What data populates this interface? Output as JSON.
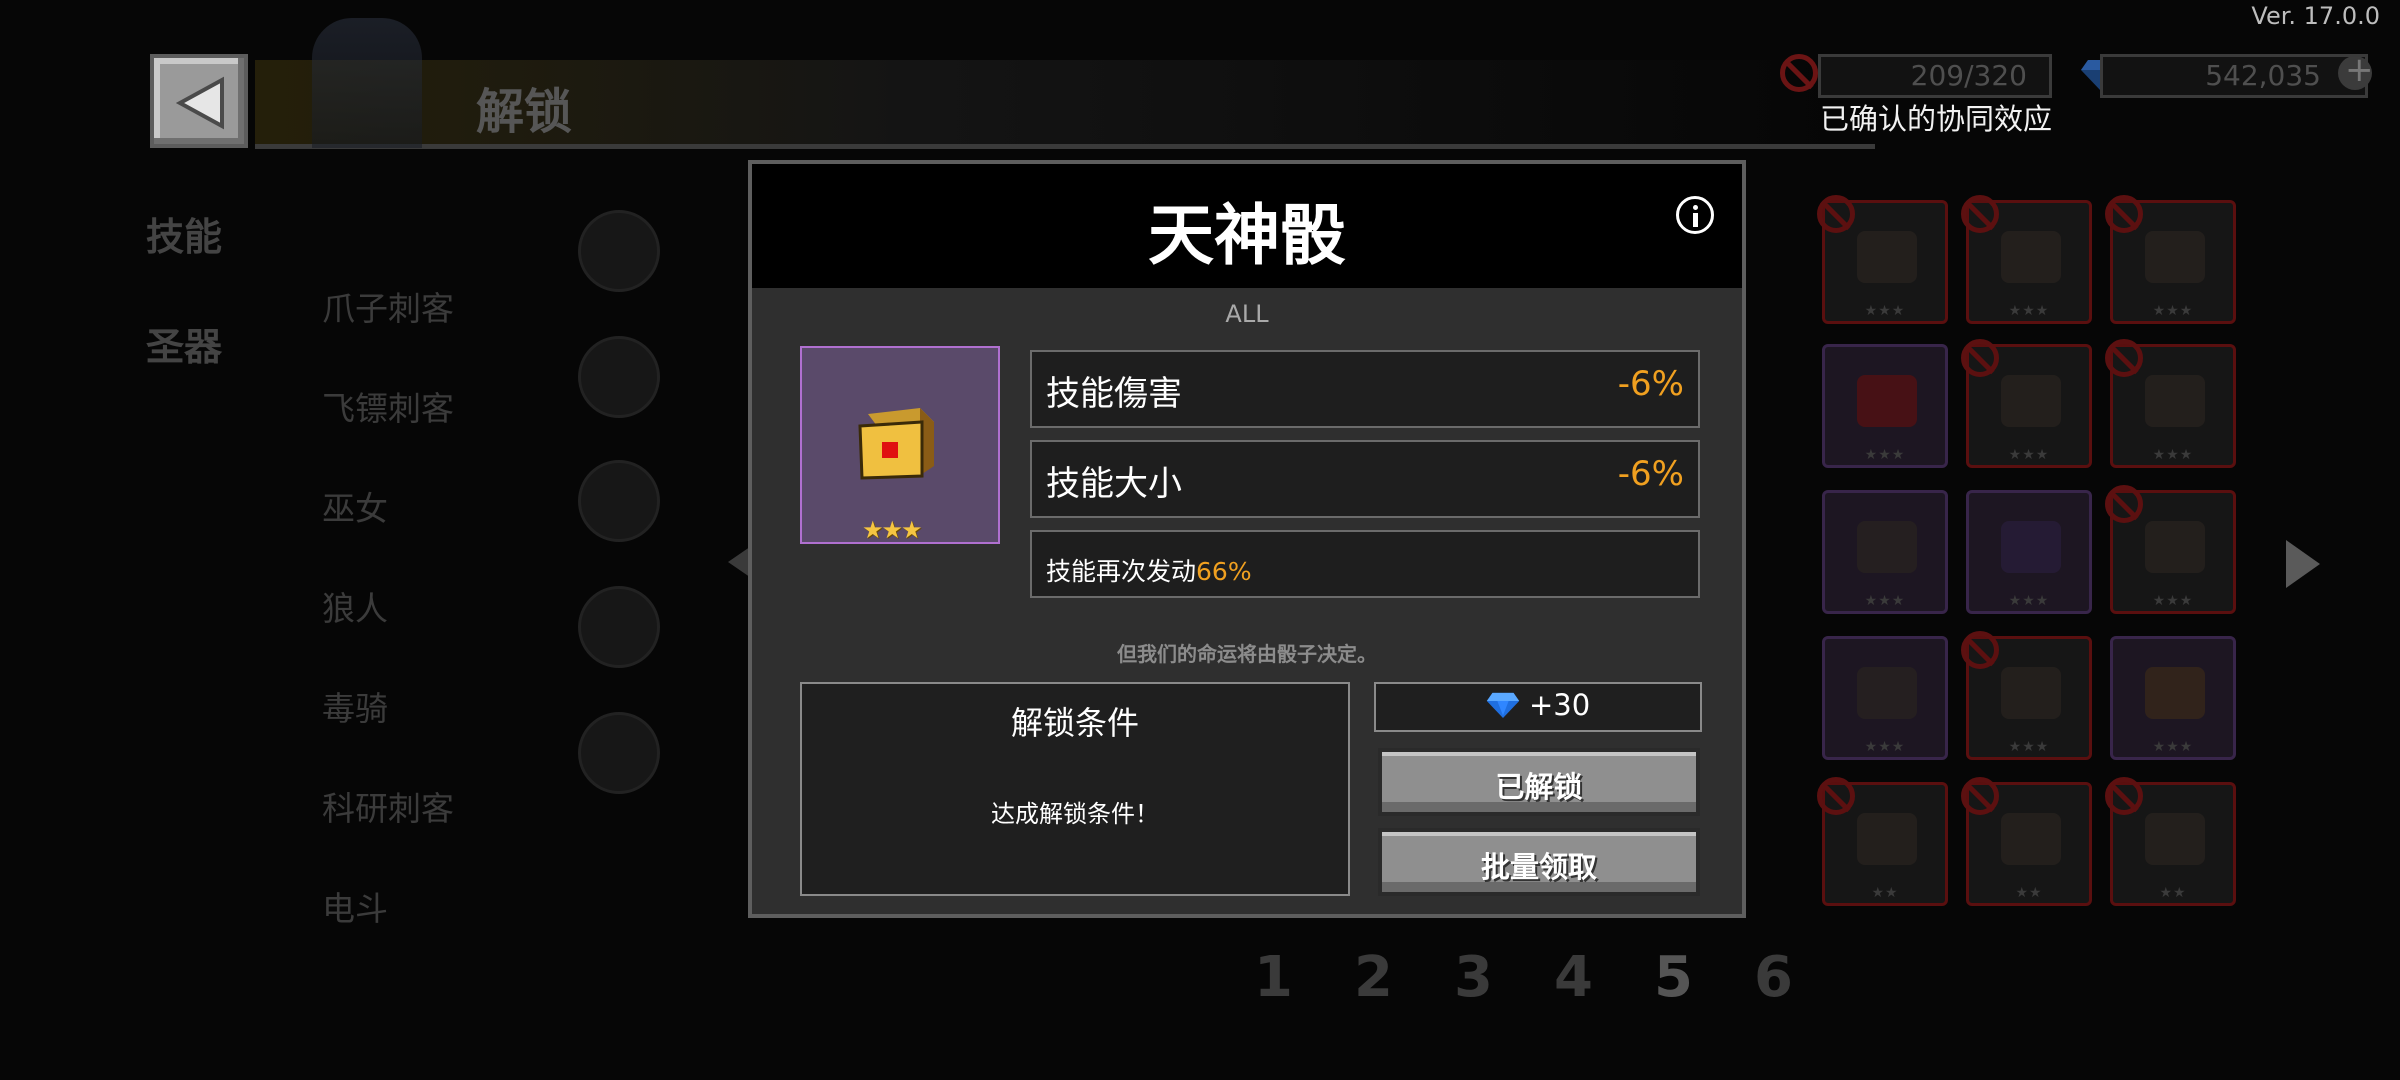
{
  "app": {
    "version": "Ver. 17.0.0"
  },
  "header": {
    "title": "解锁",
    "resource1": {
      "value": "209/320",
      "icon": "forbidden-icon"
    },
    "resource2": {
      "value": "542,035",
      "icon": "diamond-icon"
    },
    "synergy_label": "已确认的协同效应"
  },
  "sidebar": {
    "categories": [
      {
        "label": "技能"
      },
      {
        "label": "圣器"
      }
    ]
  },
  "classes": [
    {
      "label": "爪子刺客"
    },
    {
      "label": "飞镖刺客"
    },
    {
      "label": "巫女"
    },
    {
      "label": "狼人"
    },
    {
      "label": "毒骑"
    },
    {
      "label": "科研刺客"
    },
    {
      "label": "电斗"
    }
  ],
  "pagination": {
    "pages": [
      "1",
      "2",
      "3",
      "4",
      "5",
      "6"
    ],
    "current": "5"
  },
  "modal": {
    "title": "天神骰",
    "tag": "ALL",
    "rarity_stars": "★★★",
    "stats": [
      {
        "label": "技能傷害",
        "value": "-6%"
      },
      {
        "label": "技能大小",
        "value": "-6%"
      }
    ],
    "extra": {
      "label": "技能再次发动",
      "value": "66%"
    },
    "flavor": "但我们的命运将由骰子决定。",
    "condition": {
      "title": "解锁条件",
      "text": "达成解锁条件！"
    },
    "reward": {
      "text": "+30",
      "icon": "diamond-icon"
    },
    "buttons": {
      "unlocked": "已解锁",
      "batch_claim": "批量领取"
    }
  },
  "colors": {
    "accent": "#f0a020",
    "rarity_frame": "#b070d0",
    "locked_frame": "#5a0f0f",
    "diamond": "#3a8bff"
  }
}
